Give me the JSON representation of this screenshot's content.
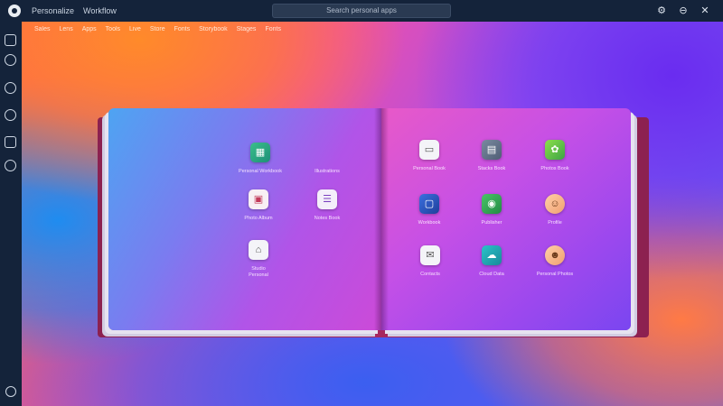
{
  "window": {
    "title_left": "Personalize",
    "title_right": "Workflow",
    "search_placeholder": "Search personal apps"
  },
  "menu": {
    "items": [
      "Sales",
      "Lens",
      "Apps",
      "Tools",
      "Live",
      "Store",
      "Fonts",
      "Storybook",
      "Stages",
      "Fonts"
    ]
  },
  "window_controls": {
    "settings_glyph": "⚙",
    "minimize_glyph": "⊖",
    "close_glyph": "✕"
  },
  "left_page_apps": [
    {
      "label": "Personal Workbook",
      "icon": "spreadsheet-icon",
      "glyph": "▦"
    },
    {
      "label": "Illustrations",
      "icon": "blank-icon",
      "glyph": ""
    },
    {
      "label": "Photo Album",
      "icon": "photo-frame-icon",
      "glyph": "▣"
    },
    {
      "label": "Notes Book",
      "icon": "notes-icon",
      "glyph": "☰"
    },
    {
      "label": "Studio",
      "icon": "studio-icon",
      "glyph": "⌂"
    }
  ],
  "right_page_apps": [
    {
      "label": "Personal Book",
      "icon": "document-icon",
      "glyph": "▭"
    },
    {
      "label": "Stacks Book",
      "icon": "stack-icon",
      "glyph": "▤"
    },
    {
      "label": "Photos Book",
      "icon": "photos-icon",
      "glyph": "✿"
    },
    {
      "label": "Workbook",
      "icon": "window-icon",
      "glyph": "▢"
    },
    {
      "label": "Publisher",
      "icon": "publisher-icon",
      "glyph": "◉"
    },
    {
      "label": "Profile",
      "icon": "person-icon",
      "glyph": "☺"
    },
    {
      "label": "Contacts",
      "icon": "contacts-icon",
      "glyph": "✉"
    },
    {
      "label": "Cloud Data",
      "icon": "cloud-icon",
      "glyph": "☁"
    },
    {
      "label": "Personal Photos",
      "icon": "person-icon",
      "glyph": "☻"
    }
  ],
  "sublabel": "Personal"
}
